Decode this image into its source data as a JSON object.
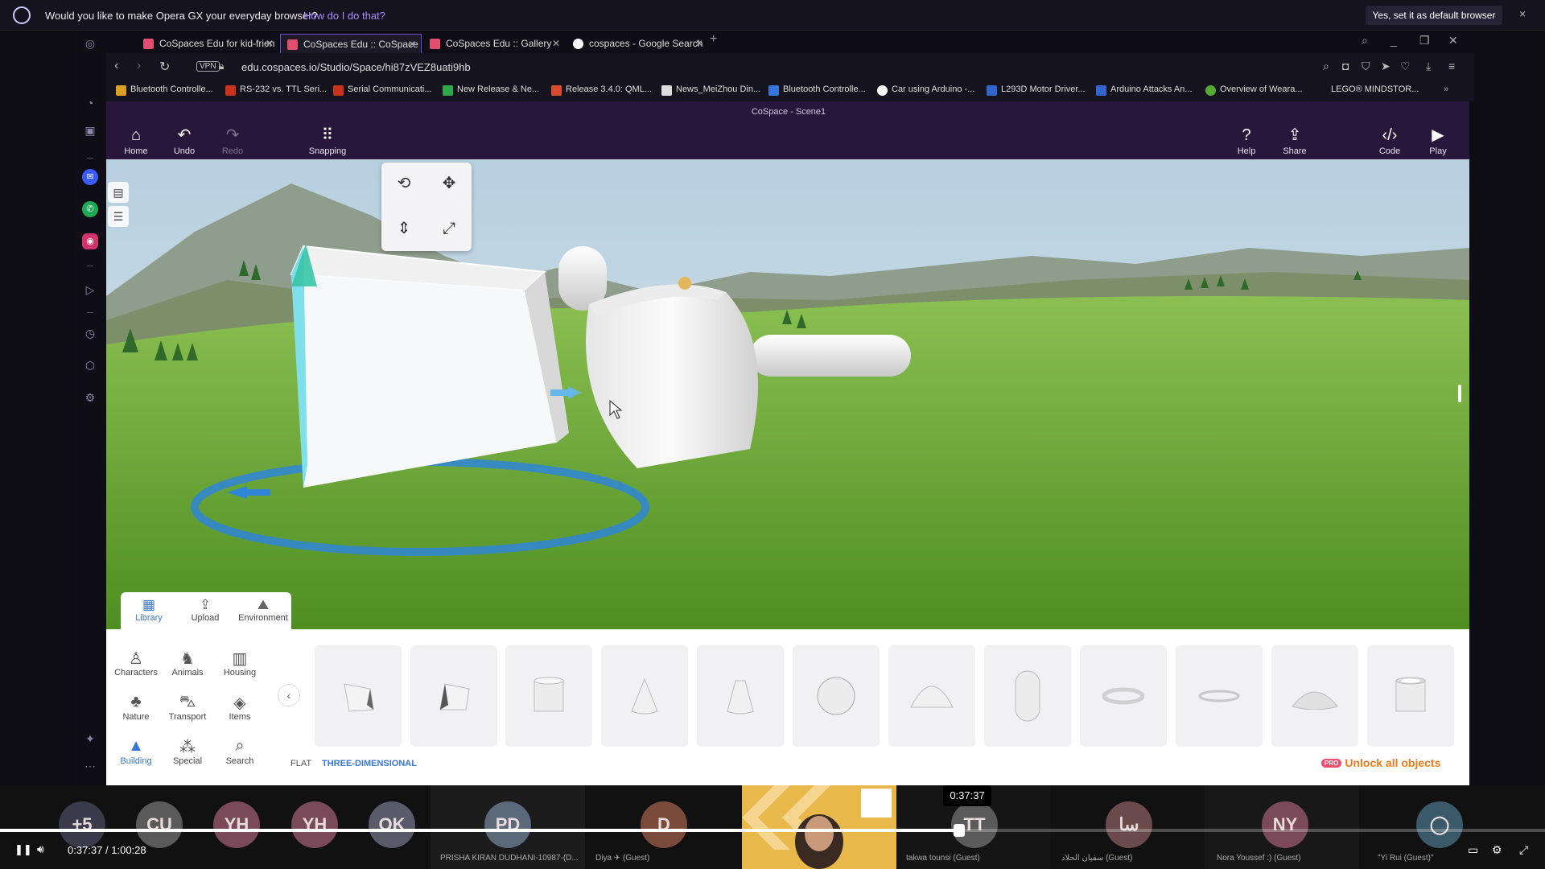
{
  "banner": {
    "message": "Would you like to make Opera GX your everyday browser?",
    "how": "How do I do that?",
    "default_button": "Yes, set it as default browser",
    "close": "×"
  },
  "tabs": [
    {
      "label": "CoSpaces Edu for kid-frien"
    },
    {
      "label": "CoSpaces Edu :: CoSpace"
    },
    {
      "label": "CoSpaces Edu :: Gallery"
    },
    {
      "label": "cospaces - Google Search"
    }
  ],
  "address": {
    "vpn": "VPN",
    "url": "edu.cospaces.io/Studio/Space/hi87zVEZ8uati9hb"
  },
  "bookmarks": [
    {
      "label": "Bluetooth Controlle...",
      "color": "#d9a023"
    },
    {
      "label": "RS-232 vs. TTL Seri...",
      "color": "#c8321f"
    },
    {
      "label": "Serial Communicati...",
      "color": "#c8321f"
    },
    {
      "label": "New Release & Ne...",
      "color": "#2fa84a"
    },
    {
      "label": "Release 3.4.0: QML...",
      "color": "#d94a2f"
    },
    {
      "label": "News_MeiZhou Din...",
      "color": "#dddddd"
    },
    {
      "label": "Bluetooth Controlle...",
      "color": "#3377dd"
    },
    {
      "label": "Car using Arduino -...",
      "color": "#ffffff"
    },
    {
      "label": "L293D Motor Driver...",
      "color": "#3366cc"
    },
    {
      "label": "Arduino Attacks An...",
      "color": "#3366cc"
    },
    {
      "label": "Overview of Weara...",
      "color": "#55aa33"
    },
    {
      "label": "LEGO® MINDSTOR...",
      "color": "#15131e"
    }
  ],
  "app": {
    "scene_title": "CoSpace - Scene1",
    "toolbar": {
      "home": "Home",
      "undo": "Undo",
      "redo": "Redo",
      "snapping": "Snapping",
      "help": "Help",
      "share": "Share",
      "code": "Code",
      "play": "Play"
    },
    "library_tabs": {
      "library": "Library",
      "upload": "Upload",
      "environment": "Environment"
    },
    "categories": {
      "characters": "Characters",
      "animals": "Animals",
      "housing": "Housing",
      "nature": "Nature",
      "transport": "Transport",
      "items": "Items",
      "building": "Building",
      "special": "Special",
      "search": "Search"
    },
    "modes": {
      "flat": "FLAT",
      "three_d": "THREE-DIMENSIONAL"
    },
    "unlock": {
      "pro": "PRO",
      "label": "Unlock all objects"
    },
    "accent_color": "#3a77d6"
  },
  "conference": {
    "participants": [
      {
        "initials": "+5",
        "name": "",
        "color": "#3a3a4a"
      },
      {
        "initials": "CU",
        "name": "",
        "color": "#5a5a5a"
      },
      {
        "initials": "YH",
        "name": "",
        "color": "#7a4a5a"
      },
      {
        "initials": "YH",
        "name": "",
        "color": "#7a4a5a"
      },
      {
        "initials": "OK",
        "name": "",
        "color": "#5a5a6a"
      },
      {
        "initials": "PD",
        "name": "PRISHA KIRAN DUDHANI-10987-(D...",
        "color": "#5a6a7a"
      },
      {
        "initials": "D",
        "name": "Diya ✈ (Guest)",
        "color": "#7a4a3a"
      },
      {
        "initials": "TT",
        "name": "takwa tounsi (Guest)",
        "color": "#5a5a5a"
      },
      {
        "initials": "سا",
        "name": "سفيان الحلاد (Guest)",
        "color": "#6a4a4a"
      },
      {
        "initials": "NY",
        "name": "Nora Youssef :) (Guest)",
        "color": "#7a4a5a"
      },
      {
        "initials": "",
        "name": "\"Yi Rui (Guest)\"",
        "color": "#3a5a6a"
      }
    ]
  },
  "player": {
    "current": "0:37:37",
    "total": "1:00:28",
    "separator": "/",
    "tooltip": "0:37:37",
    "progress_fraction": 0.621
  }
}
